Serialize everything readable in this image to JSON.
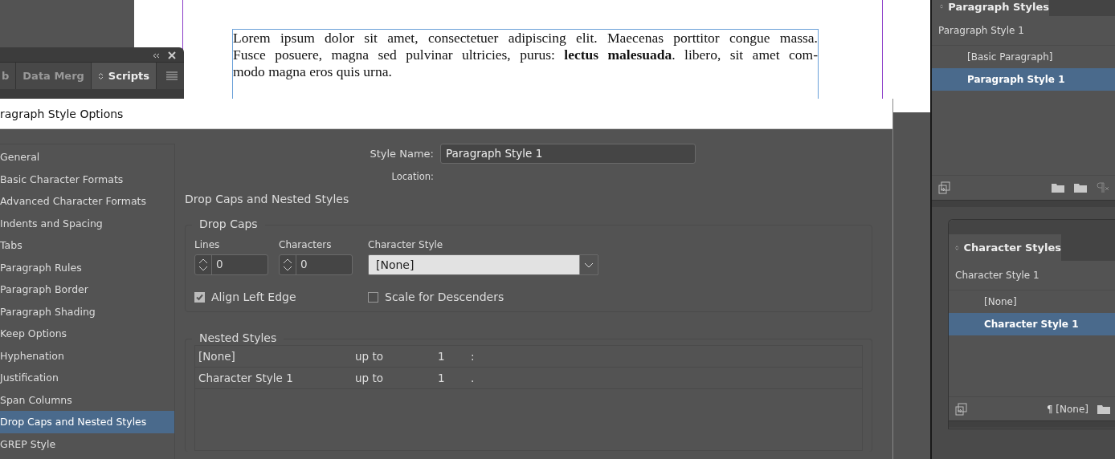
{
  "document": {
    "paragraph_lines": [
      "Lorem ipsum dolor sit amet, consectetuer adipiscing elit. Maecenas porttitor congue massa.",
      "Fusce posuere, magna sed pulvinar ultricies, purus: **lectus malesuada**. libero, sit amet com-",
      "modo magna eros quis urna."
    ]
  },
  "scripts_panel": {
    "tabs": [
      {
        "label": "b",
        "selected": false
      },
      {
        "label": "Data Merg",
        "selected": false
      },
      {
        "label": "Scripts",
        "selected": true
      }
    ]
  },
  "dialog": {
    "title": "ragraph Style Options",
    "categories": [
      {
        "label": "General",
        "selected": false
      },
      {
        "label": "Basic Character Formats",
        "selected": false
      },
      {
        "label": "Advanced Character Formats",
        "selected": false
      },
      {
        "label": "Indents and Spacing",
        "selected": false
      },
      {
        "label": "Tabs",
        "selected": false
      },
      {
        "label": "Paragraph Rules",
        "selected": false
      },
      {
        "label": "Paragraph Border",
        "selected": false
      },
      {
        "label": "Paragraph Shading",
        "selected": false
      },
      {
        "label": "Keep Options",
        "selected": false
      },
      {
        "label": "Hyphenation",
        "selected": false
      },
      {
        "label": "Justification",
        "selected": false
      },
      {
        "label": "Span Columns",
        "selected": false
      },
      {
        "label": "Drop Caps and Nested Styles",
        "selected": true
      },
      {
        "label": "GREP Style",
        "selected": false
      }
    ],
    "style_name_label": "Style Name:",
    "style_name": "Paragraph Style 1",
    "location_label": "Location:",
    "section_title": "Drop Caps and Nested Styles",
    "drop_caps": {
      "legend": "Drop Caps",
      "lines_label": "Lines",
      "lines": "0",
      "characters_label": "Characters",
      "characters": "0",
      "character_style_label": "Character Style",
      "character_style": "[None]",
      "options": [
        {
          "label": "Align Left Edge",
          "checked": true
        },
        {
          "label": "Scale for Descenders",
          "checked": false
        }
      ]
    },
    "nested_styles": {
      "legend": "Nested Styles",
      "rows": [
        {
          "style": "[None]",
          "relation": "up to",
          "count": "1",
          "delimiter": ":"
        },
        {
          "style": "Character Style 1",
          "relation": "up to",
          "count": "1",
          "delimiter": "."
        }
      ]
    }
  },
  "paragraph_styles_panel": {
    "tab": "Paragraph Styles",
    "current": "Paragraph Style 1",
    "items": [
      {
        "label": "[Basic Paragraph]",
        "selected": false
      },
      {
        "label": "Paragraph Style 1",
        "selected": true
      }
    ]
  },
  "character_styles_panel": {
    "tab": "Character Styles",
    "current": "Character Style 1",
    "items": [
      {
        "label": "[None]",
        "selected": false
      },
      {
        "label": "Character Style 1",
        "selected": true
      }
    ],
    "footer_style": "¶ [None]"
  }
}
